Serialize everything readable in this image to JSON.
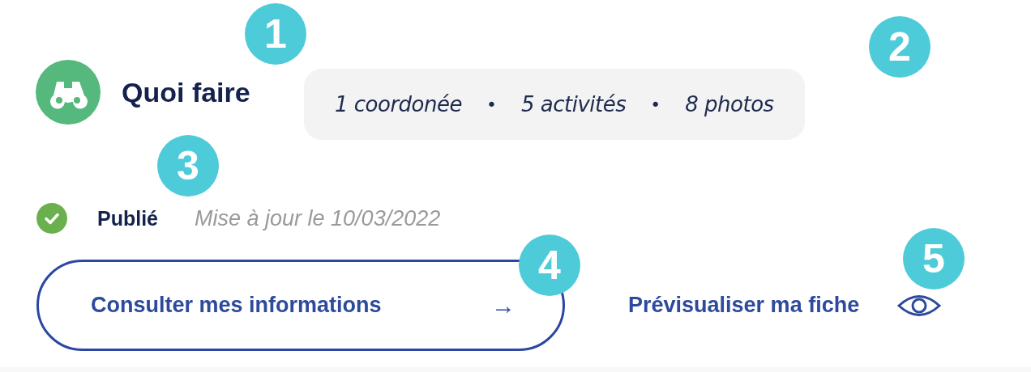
{
  "header": {
    "title": "Quoi faire",
    "stats": [
      "1 coordonée",
      "5 activités",
      "8 photos"
    ],
    "separator": "•"
  },
  "status": {
    "published": true,
    "label": "Publié",
    "updated": "Mise à jour le 10/03/2022"
  },
  "actions": {
    "primary": {
      "label": "Consulter mes informations",
      "arrow": "→"
    },
    "preview": {
      "label": "Prévisualiser ma fiche"
    }
  },
  "callouts": [
    "1",
    "2",
    "3",
    "4",
    "5"
  ]
}
